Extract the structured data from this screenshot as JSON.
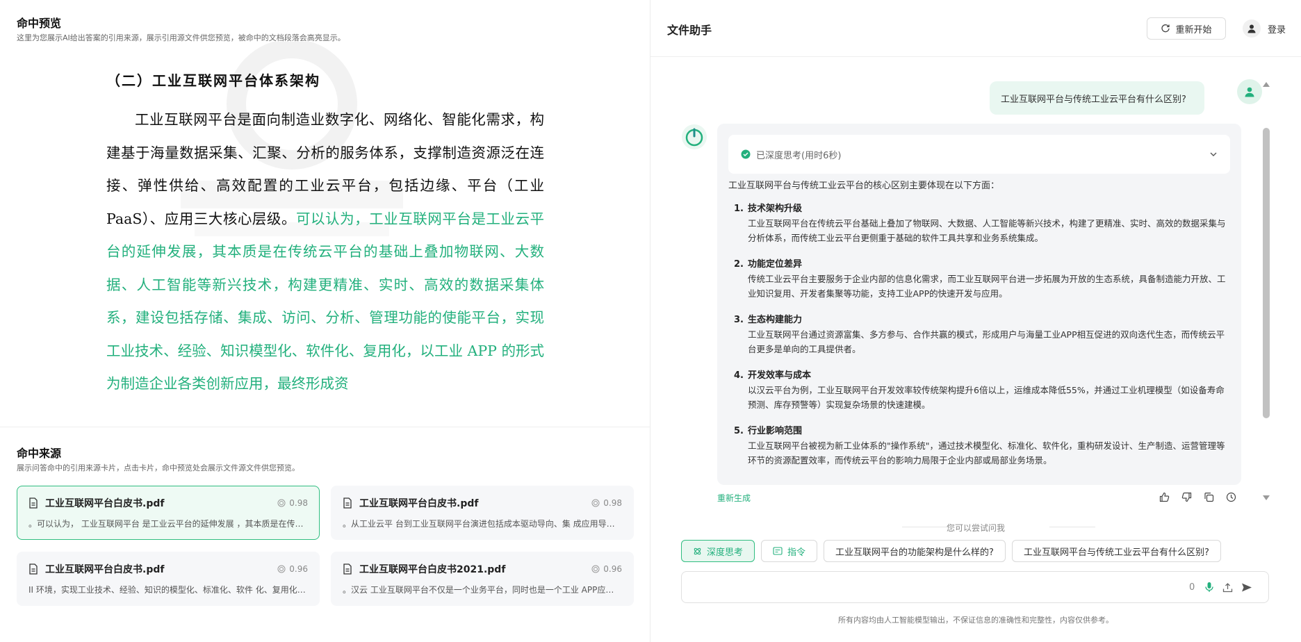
{
  "preview": {
    "title": "命中预览",
    "subtitle": "这里为您展示AI给出答案的引用来源，展示引用源文件供您预览，被命中的文档段落会高亮显示。",
    "heading": "（二）工业互联网平台体系架构",
    "para_normal": "工业互联网平台是面向制造业数字化、网络化、智能化需求，构建基于海量数据采集、汇聚、分析的服务体系，支撑制造资源泛在连接、弹性供给、高效配置的工业云平台，包括边缘、平台（工业 PaaS）、应用三大核心层级。",
    "para_highlight": "可以认为，工业互联网平台是工业云平台的延伸发展，其本质是在传统云平台的基础上叠加物联网、大数据、人工智能等新兴技术，构建更精准、实时、高效的数据采集体系，建设包括存储、集成、访问、分析、管理功能的使能平台，实现工业技术、经验、知识模型化、软件化、复用化，以工业 APP 的形式为制造企业各类创新应用，最终形成资",
    "highlight_color": "#23b07d"
  },
  "sources": {
    "title": "命中来源",
    "subtitle": "展示问答命中的引用来源卡片，点击卡片，命中预览处会展示文件源文件供您预览。",
    "cards": [
      {
        "name": "工业互联网平台白皮书.pdf",
        "score": "0.98",
        "snippet": "。可以认为， 工业互联网平台 是工业云平台的延伸发展 ，其本质是在传统云平台的基础上叠加物联网、大数据"
      },
      {
        "name": "工业互联网平台白皮书.pdf",
        "score": "0.98",
        "snippet": "。从工业云平 台到工业互联网平台演进包括成本驱动导向、集 成应用导向、能力交易导向、创新引领导向"
      },
      {
        "name": "工业互联网平台白皮书.pdf",
        "score": "0.96",
        "snippet": "II 环境，实现工业技术、经验、知识的模型化、标准化、软件 化、复用化，以工业 APP 的形式为制造企业"
      },
      {
        "name": "工业互联网平台白皮书2021.pdf",
        "score": "0.96",
        "snippet": "。汉云 工业互联网平台不仅是一个业务平台，同时也是一个工业 APP应用的开发平台和交易平台"
      }
    ]
  },
  "assistant": {
    "title": "文件助手",
    "restart_label": "重新开始",
    "login_label": "登录",
    "user_question": "工业互联网平台与传统工业云平台有什么区别?",
    "think_label": "已深度思考(用时6秒)",
    "answer_intro": "工业互联网平台与传统工业云平台的核心区别主要体现在以下方面：",
    "answer_items": [
      {
        "num": "1.",
        "title": "技术架构升级",
        "text": "工业互联网平台在传统云平台基础上叠加了物联网、大数据、人工智能等新兴技术，构建了更精准、实时、高效的数据采集与分析体系，而传统工业云平台更侧重于基础的软件工具共享和业务系统集成。"
      },
      {
        "num": "2.",
        "title": "功能定位差异",
        "text": "传统工业云平台主要服务于企业内部的信息化需求，而工业互联网平台进一步拓展为开放的生态系统，具备制造能力开放、工业知识复用、开发者集聚等功能，支持工业APP的快速开发与应用。"
      },
      {
        "num": "3.",
        "title": "生态构建能力",
        "text": "工业互联网平台通过资源富集、多方参与、合作共赢的模式，形成用户与海量工业APP相互促进的双向迭代生态，而传统云平台更多是单向的工具提供者。"
      },
      {
        "num": "4.",
        "title": "开发效率与成本",
        "text": "以汉云平台为例，工业互联网平台开发效率较传统架构提升6倍以上，运维成本降低55%，并通过工业机理模型（如设备寿命预测、库存预警等）实现复杂场景的快速建模。"
      },
      {
        "num": "5.",
        "title": "行业影响范围",
        "text": "工业互联网平台被视为新工业体系的\"操作系统\"，通过技术模型化、标准化、软件化，重构研发设计、生产制造、运营管理等环节的资源配置效率，而传统云平台的影响力局限于企业内部或局部业务场景。"
      }
    ],
    "regen_label": "重新生成",
    "try_label": "您可以尝试问我",
    "chips": {
      "deep_think": "深度思考",
      "command": "指令",
      "q1": "工业互联网平台的功能架构是什么样的?",
      "q2": "工业互联网平台与传统工业云平台有什么区别?"
    },
    "char_count": "0",
    "disclaimer": "所有内容均由人工智能模型输出，不保证信息的准确性和完整性，内容仅供参考。",
    "accent": "#23b07d"
  }
}
